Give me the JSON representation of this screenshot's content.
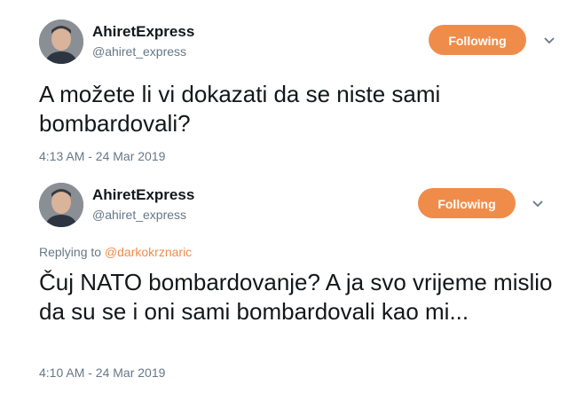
{
  "tweets": [
    {
      "author_name": "AhiretExpress",
      "author_handle": "@ahiret_express",
      "follow_label": "Following",
      "text": "A možete li vi dokazati da se niste sami bombardovali?",
      "timestamp": "4:13 AM - 24 Mar 2019"
    },
    {
      "author_name": "AhiretExpress",
      "author_handle": "@ahiret_express",
      "follow_label": "Following",
      "replying_prefix": "Replying to",
      "replying_to": "@darkokrznaric",
      "text": "Čuj NATO bombardovanje? A ja svo vrijeme mislio da su se i oni sami bombardovali kao mi...",
      "timestamp": "4:10 AM - 24 Mar 2019"
    }
  ],
  "colors": {
    "accent": "#f08c4a",
    "muted": "#657786",
    "text": "#14171a"
  },
  "icons": {
    "menu": "chevron-down-icon"
  }
}
